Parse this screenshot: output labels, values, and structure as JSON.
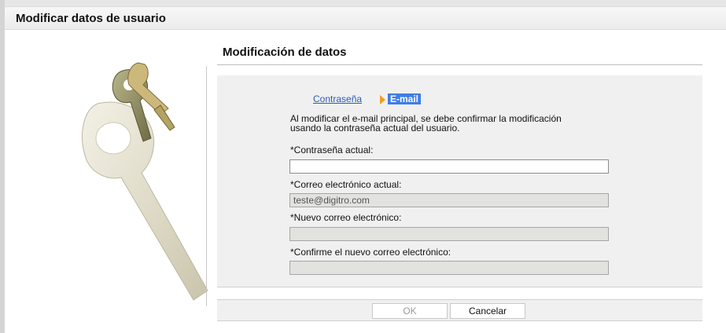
{
  "window": {
    "title": "Modificar datos de usuario"
  },
  "section": {
    "title": "Modificación de datos"
  },
  "steps": {
    "previous_label": "Contraseña",
    "current_label": "E-mail"
  },
  "description": "Al modificar el e-mail principal, se debe confirmar la modificación usando la contraseña actual del usuario.",
  "form": {
    "current_password": {
      "label": "*Contraseña actual:",
      "value": ""
    },
    "current_email": {
      "label": "*Correo electrónico actual:",
      "value": "teste@digitro.com"
    },
    "new_email": {
      "label": "*Nuevo correo electrónico:",
      "value": ""
    },
    "confirm_email": {
      "label": "*Confirme el nuevo correo electrónico:",
      "value": ""
    }
  },
  "buttons": {
    "ok_label": "OK",
    "cancel_label": "Cancelar"
  },
  "colors": {
    "accent": "#3f7de8",
    "link": "#2a5db0",
    "step_arrow": "#f0a020",
    "panel_bg": "#f0f0f0",
    "disabled_field": "#e2e2de"
  }
}
